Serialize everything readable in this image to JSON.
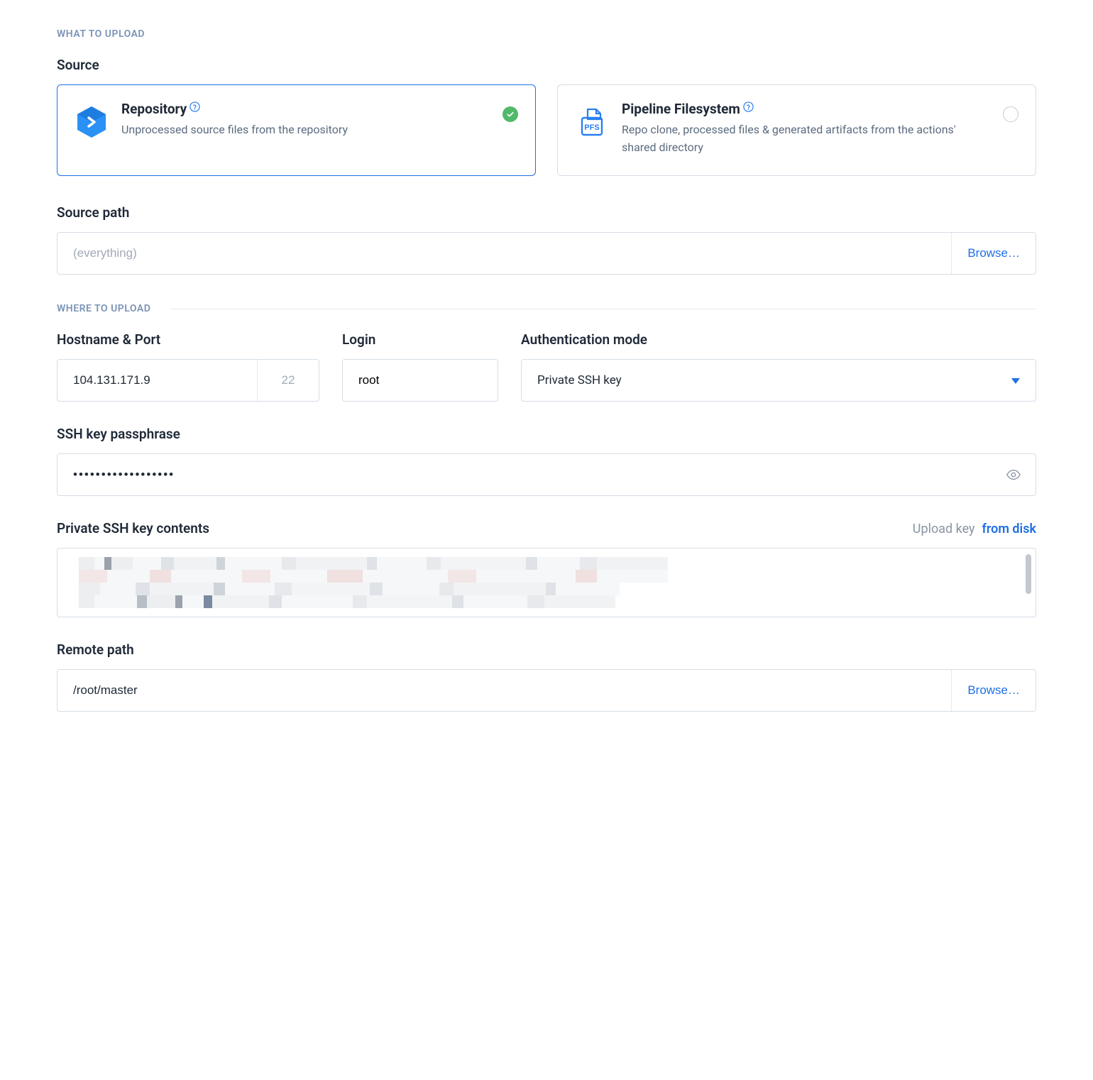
{
  "sections": {
    "what_to_upload": "WHAT TO UPLOAD",
    "where_to_upload": "WHERE TO UPLOAD"
  },
  "source": {
    "label": "Source",
    "options": {
      "repository": {
        "title": "Repository",
        "desc": "Unprocessed source files from the repository",
        "selected": true
      },
      "pipeline_fs": {
        "title": "Pipeline Filesystem",
        "desc": "Repo clone, processed files & generated artifacts from the actions' shared directory",
        "selected": false
      }
    }
  },
  "source_path": {
    "label": "Source path",
    "placeholder": "(everything)",
    "value": "",
    "browse": "Browse…"
  },
  "hostname": {
    "label": "Hostname & Port",
    "host": "104.131.171.9",
    "port": "22"
  },
  "login": {
    "label": "Login",
    "value": "root"
  },
  "auth_mode": {
    "label": "Authentication mode",
    "value": "Private SSH key"
  },
  "passphrase": {
    "label": "SSH key passphrase",
    "value": "••••••••••••••••••"
  },
  "private_key": {
    "label": "Private SSH key contents",
    "upload_text": "Upload key",
    "upload_link": "from disk"
  },
  "remote_path": {
    "label": "Remote path",
    "value": "/root/master",
    "browse": "Browse…"
  }
}
